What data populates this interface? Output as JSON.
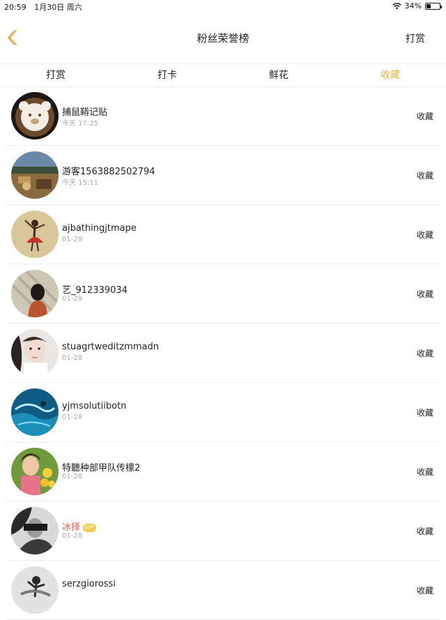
{
  "status_bar": {
    "time": "20:59",
    "date": "1月30日 周六",
    "wifi_icon": "wifi-icon",
    "battery": "34%",
    "battery_level": 0.34
  },
  "nav": {
    "title": "粉丝荣誉榜",
    "right_label": "打赏",
    "back_icon": "chevron-left-icon"
  },
  "colors": {
    "accent": "#e7b63e",
    "vip_name": "#e25c4a"
  },
  "tabs": [
    {
      "label": "打赏",
      "active": false
    },
    {
      "label": "打卡",
      "active": false
    },
    {
      "label": "鲜花",
      "active": false
    },
    {
      "label": "收藏",
      "active": true
    }
  ],
  "fans": [
    {
      "name": "捕鼠鞯记贴",
      "time": "今天 17:25",
      "action": "收藏",
      "vip": false,
      "avatar": "latte-art-avatar"
    },
    {
      "name": "游客1563882502794",
      "time": "今天 15:11",
      "action": "收藏",
      "vip": false,
      "avatar": "landscape-avatar"
    },
    {
      "name": "ajbathingjtmape",
      "time": "01-29",
      "action": "收藏",
      "vip": false,
      "avatar": "dancer-avatar"
    },
    {
      "name": "艺_912339034",
      "time": "01-29",
      "action": "收藏",
      "vip": false,
      "avatar": "girl-back-avatar"
    },
    {
      "name": "stuagrtweditzmmadn",
      "time": "01-28",
      "action": "收藏",
      "vip": false,
      "avatar": "portrait-avatar"
    },
    {
      "name": "yjmsolutiibotn",
      "time": "01-28",
      "action": "收藏",
      "vip": false,
      "avatar": "ocean-avatar"
    },
    {
      "name": "特聽种部甲队传檬2",
      "time": "01-28",
      "action": "收藏",
      "vip": false,
      "avatar": "flowers-avatar"
    },
    {
      "name": "冰择",
      "time": "01-28",
      "action": "收藏",
      "vip": true,
      "vip_label": "VIP",
      "avatar": "bw-photo-avatar"
    },
    {
      "name": "serzgiorossi",
      "time": "",
      "action": "收藏",
      "vip": false,
      "avatar": "bw-figure-avatar"
    }
  ]
}
